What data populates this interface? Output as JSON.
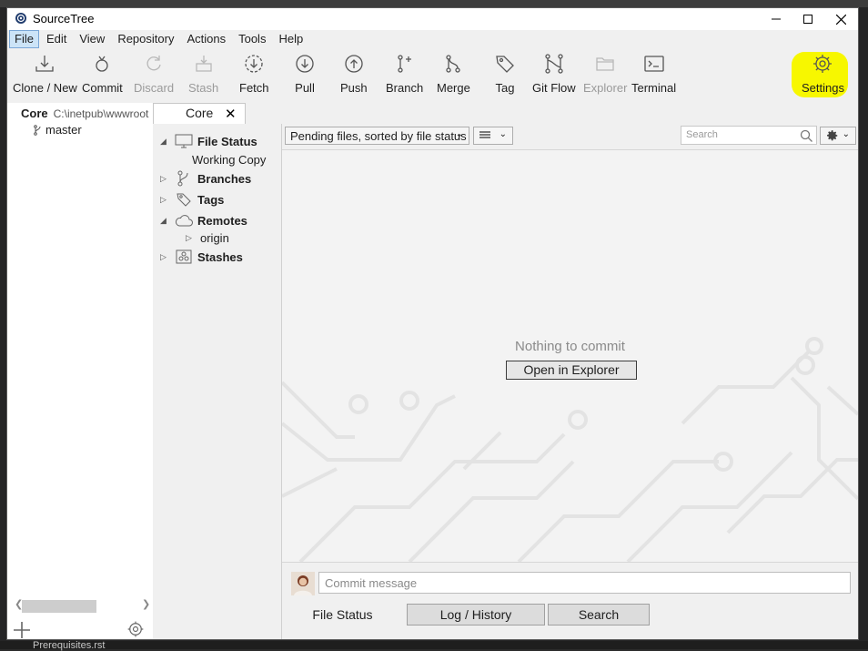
{
  "window": {
    "title": "SourceTree"
  },
  "menu": [
    "File",
    "Edit",
    "View",
    "Repository",
    "Actions",
    "Tools",
    "Help"
  ],
  "toolbar": {
    "clone": "Clone / New",
    "commit": "Commit",
    "discard": "Discard",
    "stash": "Stash",
    "fetch": "Fetch",
    "pull": "Pull",
    "push": "Push",
    "branch": "Branch",
    "merge": "Merge",
    "tag": "Tag",
    "gitflow": "Git Flow",
    "explorer": "Explorer",
    "terminal": "Terminal",
    "settings": "Settings",
    "highlight_color": "#f7f700"
  },
  "sidebar": {
    "repo_name": "Core",
    "repo_path": "C:\\inetpub\\wwwroot",
    "branch": "master"
  },
  "tab": {
    "label": "Core",
    "close": "✕"
  },
  "tree": {
    "file_status": "File Status",
    "working_copy": "Working Copy",
    "branches": "Branches",
    "tags": "Tags",
    "remotes": "Remotes",
    "origin": "origin",
    "stashes": "Stashes"
  },
  "filter": {
    "sort_label": "Pending files, sorted by file status",
    "search_placeholder": "Search"
  },
  "main": {
    "empty_message": "Nothing to commit",
    "open_button": "Open in Explorer"
  },
  "commit": {
    "placeholder": "Commit message"
  },
  "bottom_tabs": [
    "File Status",
    "Log / History",
    "Search"
  ],
  "background": {
    "file_label": "Prerequisites.rst"
  }
}
